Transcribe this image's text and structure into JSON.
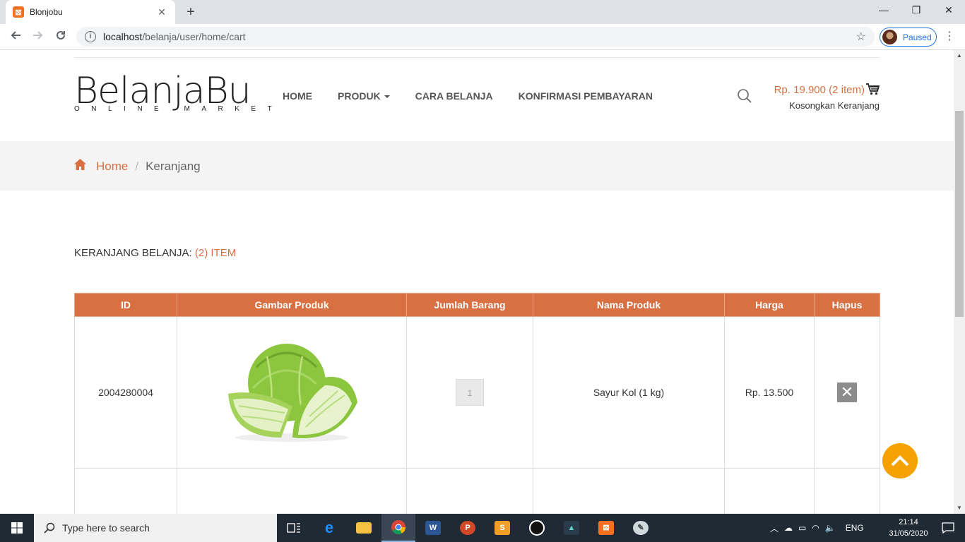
{
  "browser": {
    "tab_title": "Blonjobu",
    "tab_close": "✕",
    "new_tab": "+",
    "url_host": "localhost",
    "url_path": "/belanja/user/home/cart",
    "profile_status": "Paused",
    "win_min": "—",
    "win_restore": "❐",
    "win_close": "✕"
  },
  "site": {
    "logo": "BelanjaBu",
    "tagline": "ONLINE MARKET",
    "nav": [
      {
        "label": "HOME"
      },
      {
        "label": "PRODUK"
      },
      {
        "label": "CARA BELANJA"
      },
      {
        "label": "KONFIRMASI PEMBAYARAN"
      }
    ],
    "cart_total": "Rp. 19.900 (2 item)",
    "cart_empty_link": "Kosongkan Keranjang",
    "accent": "#d97042"
  },
  "breadcrumb": {
    "home": "Home",
    "separator": "/",
    "current": "Keranjang"
  },
  "cart": {
    "heading": "KERANJANG BELANJA:",
    "count": "(2) ITEM",
    "columns": [
      "ID",
      "Gambar Produk",
      "Jumlah Barang",
      "Nama Produk",
      "Harga",
      "Hapus"
    ],
    "rows": [
      {
        "id": "2004280004",
        "image": "cabbage",
        "qty": "1",
        "name": "Sayur Kol (1 kg)",
        "price": "Rp. 13.500",
        "delete": "✕"
      }
    ]
  },
  "taskbar": {
    "search_placeholder": "Type here to search",
    "language": "ENG",
    "time": "21:14",
    "date": "31/05/2020",
    "apps": [
      "task-view",
      "edge",
      "file-explorer",
      "chrome",
      "word",
      "powerpoint",
      "sublime-text",
      "inkscape",
      "filmora",
      "xampp",
      "paint"
    ]
  }
}
